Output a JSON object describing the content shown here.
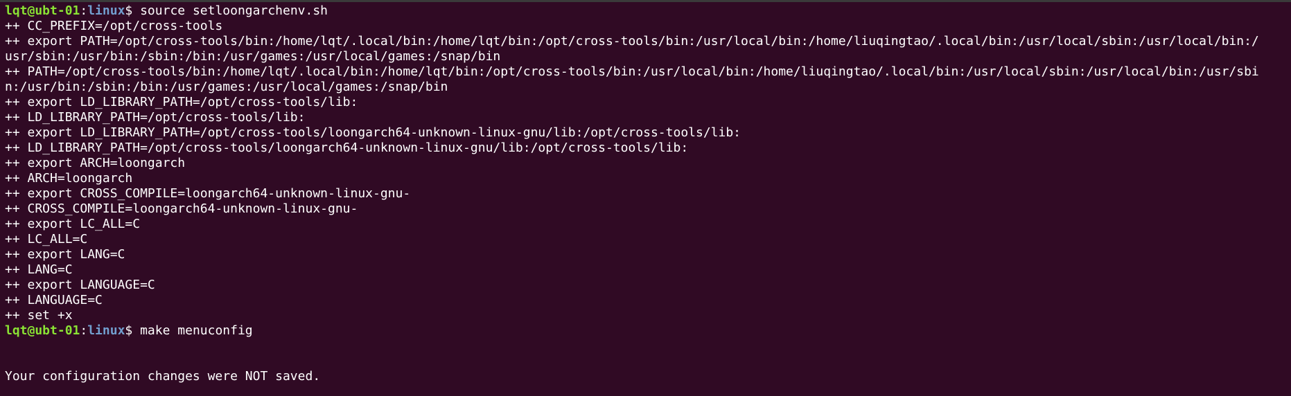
{
  "prompt1": {
    "user": "lqt@ubt-01",
    "sep": ":",
    "path": "linux",
    "symbol": "$ ",
    "command": "source setloongarchenv.sh"
  },
  "output1": [
    "++ CC_PREFIX=/opt/cross-tools",
    "++ export PATH=/opt/cross-tools/bin:/home/lqt/.local/bin:/home/lqt/bin:/opt/cross-tools/bin:/usr/local/bin:/home/liuqingtao/.local/bin:/usr/local/sbin:/usr/local/bin:/",
    "usr/sbin:/usr/bin:/sbin:/bin:/usr/games:/usr/local/games:/snap/bin",
    "++ PATH=/opt/cross-tools/bin:/home/lqt/.local/bin:/home/lqt/bin:/opt/cross-tools/bin:/usr/local/bin:/home/liuqingtao/.local/bin:/usr/local/sbin:/usr/local/bin:/usr/sbi",
    "n:/usr/bin:/sbin:/bin:/usr/games:/usr/local/games:/snap/bin",
    "++ export LD_LIBRARY_PATH=/opt/cross-tools/lib:",
    "++ LD_LIBRARY_PATH=/opt/cross-tools/lib:",
    "++ export LD_LIBRARY_PATH=/opt/cross-tools/loongarch64-unknown-linux-gnu/lib:/opt/cross-tools/lib:",
    "++ LD_LIBRARY_PATH=/opt/cross-tools/loongarch64-unknown-linux-gnu/lib:/opt/cross-tools/lib:",
    "++ export ARCH=loongarch",
    "++ ARCH=loongarch",
    "++ export CROSS_COMPILE=loongarch64-unknown-linux-gnu-",
    "++ CROSS_COMPILE=loongarch64-unknown-linux-gnu-",
    "++ export LC_ALL=C",
    "++ LC_ALL=C",
    "++ export LANG=C",
    "++ LANG=C",
    "++ export LANGUAGE=C",
    "++ LANGUAGE=C",
    "++ set +x"
  ],
  "prompt2": {
    "user": "lqt@ubt-01",
    "sep": ":",
    "path": "linux",
    "symbol": "$ ",
    "command": "make menuconfig"
  },
  "output2": [
    "",
    "",
    "Your configuration changes were NOT saved."
  ],
  "colors": {
    "background": "#300a24",
    "prompt_user": "#8ae234",
    "prompt_path": "#729fcf",
    "text": "#ffffff"
  }
}
